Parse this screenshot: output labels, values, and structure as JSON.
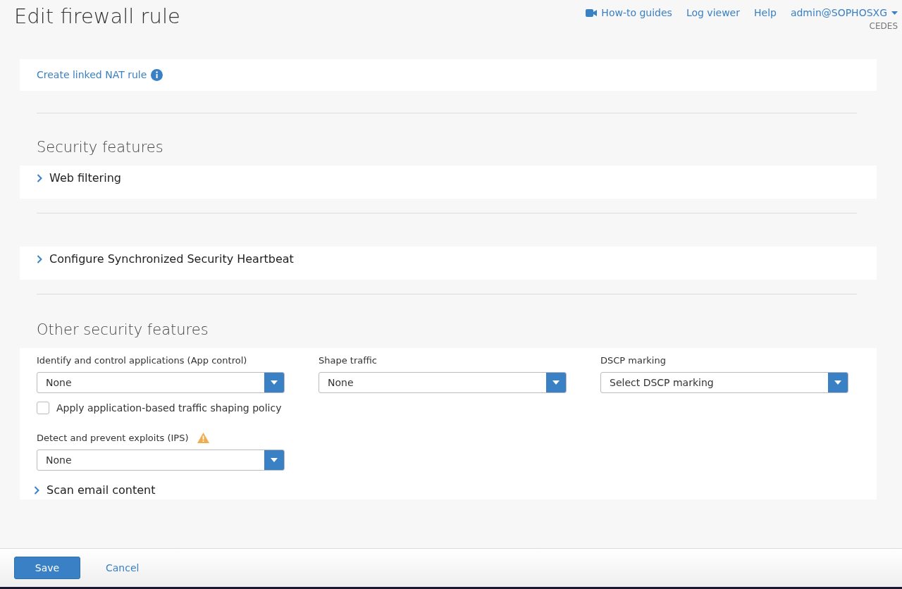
{
  "header": {
    "title": "Edit firewall rule",
    "links": [
      {
        "kind": "video",
        "label": "How-to guides"
      },
      {
        "kind": "plain",
        "label": "Log viewer"
      },
      {
        "kind": "plain",
        "label": "Help"
      }
    ],
    "user": "admin@SOPHOSXG",
    "org": "CEDES"
  },
  "nat_link": {
    "label": "Create linked NAT rule"
  },
  "security_features": {
    "heading": "Security features",
    "expanders": [
      {
        "label": "Web filtering",
        "expanded": false
      }
    ]
  },
  "heartbeat": {
    "expanders": [
      {
        "label": "Configure Synchronized Security Heartbeat",
        "expanded": false
      }
    ]
  },
  "other_features": {
    "heading": "Other security features",
    "selects": [
      {
        "label": "Identify and control applications (App control)",
        "value": "None",
        "warning": false
      },
      {
        "label": "Shape traffic",
        "value": "None",
        "warning": false
      },
      {
        "label": "DSCP marking",
        "value": "Select DSCP marking",
        "warning": false
      }
    ],
    "checkbox": {
      "label": "Apply application-based traffic shaping policy",
      "checked": false
    },
    "ips": {
      "label": "Detect and prevent exploits (IPS)",
      "value": "None",
      "warning": true
    },
    "expanders": [
      {
        "label": "Scan email content",
        "expanded": false
      }
    ]
  },
  "footer": {
    "buttons": [
      {
        "kind": "primary",
        "label": "Save"
      },
      {
        "kind": "link",
        "label": "Cancel"
      }
    ]
  }
}
